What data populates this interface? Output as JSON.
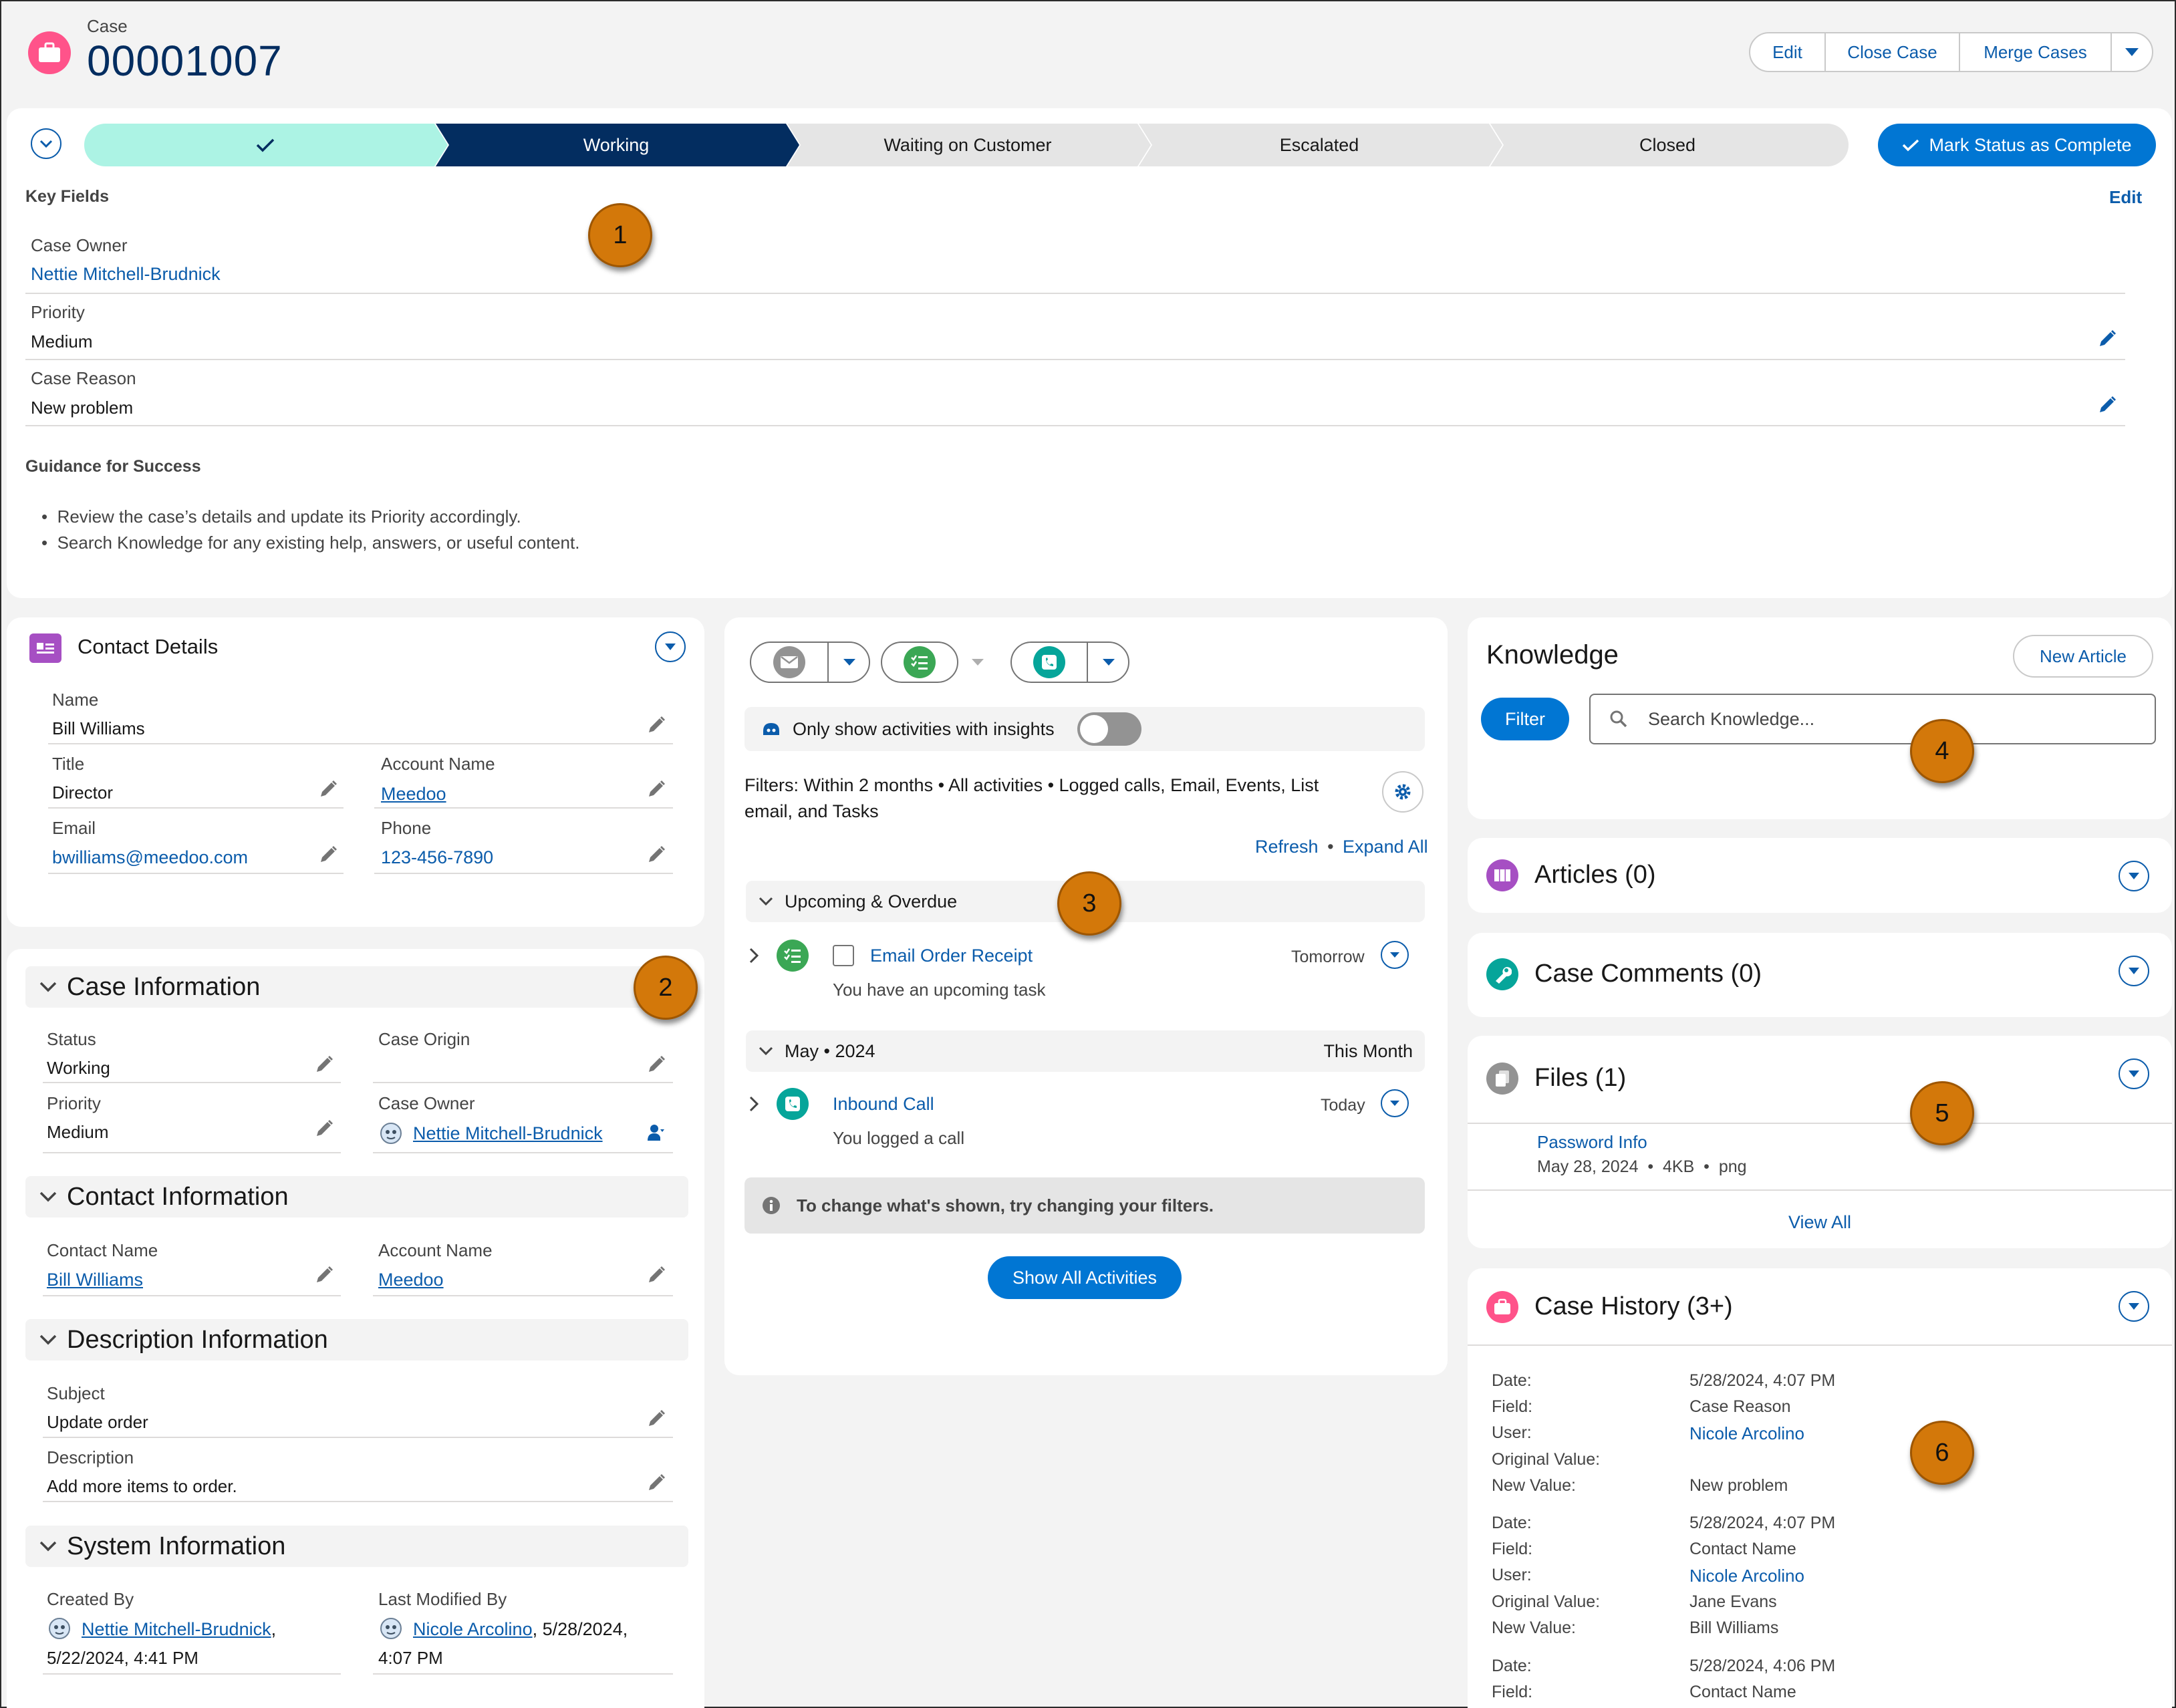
{
  "header": {
    "object_label": "Case",
    "record_number": "00001007",
    "buttons": {
      "edit": "Edit",
      "close_case": "Close Case",
      "merge_cases": "Merge Cases"
    }
  },
  "path": {
    "steps": [
      "Working",
      "Waiting on Customer",
      "Escalated",
      "Closed"
    ],
    "mark_complete": "Mark Status as Complete"
  },
  "key_fields": {
    "title": "Key Fields",
    "edit": "Edit",
    "case_owner_label": "Case Owner",
    "case_owner": "Nettie Mitchell-Brudnick",
    "priority_label": "Priority",
    "priority": "Medium",
    "case_reason_label": "Case Reason",
    "case_reason": "New problem",
    "guidance_title": "Guidance for Success",
    "guidance": [
      "Review the case’s details and update its Priority accordingly.",
      "Search Knowledge for any existing help, answers, or useful content."
    ]
  },
  "contact_details": {
    "title": "Contact Details",
    "name_label": "Name",
    "name": "Bill Williams",
    "title_label": "Title",
    "title_value": "Director",
    "account_label": "Account Name",
    "account": "Meedoo",
    "email_label": "Email",
    "email": "bwilliams@meedoo.com",
    "phone_label": "Phone",
    "phone": "123-456-7890"
  },
  "case_info": {
    "title": "Case Information",
    "status_label": "Status",
    "status": "Working",
    "origin_label": "Case Origin",
    "priority_label": "Priority",
    "priority": "Medium",
    "owner_label": "Case Owner",
    "owner": "Nettie Mitchell-Brudnick"
  },
  "contact_info": {
    "title": "Contact Information",
    "contact_name_label": "Contact Name",
    "contact_name": "Bill Williams",
    "account_label": "Account Name",
    "account": "Meedoo"
  },
  "description_info": {
    "title": "Description Information",
    "subject_label": "Subject",
    "subject": "Update order",
    "description_label": "Description",
    "description": "Add more items to order."
  },
  "system_info": {
    "title": "System Information",
    "created_label": "Created By",
    "created_by": "Nettie Mitchell-Brudnick",
    "created_sep": ",",
    "created_date": "5/22/2024, 4:41 PM",
    "modified_label": "Last Modified By",
    "modified_by": "Nicole Arcolino",
    "modified_date_a": ", 5/28/2024,",
    "modified_date_b": "4:07 PM"
  },
  "activity": {
    "insights": "Only show activities with insights",
    "filters": "Filters: Within 2 months • All activities • Logged calls, Email, Events, List email, and Tasks",
    "refresh": "Refresh",
    "sep": "•",
    "expand_all": "Expand All",
    "upcoming": "Upcoming & Overdue",
    "task_title": "Email Order Receipt",
    "task_due": "Tomorrow",
    "task_sub": "You have an upcoming task",
    "month": "May • 2024",
    "month_tag": "This Month",
    "call_title": "Inbound Call",
    "call_when": "Today",
    "call_sub": "You logged a call",
    "info": "To change what's shown, try changing your filters.",
    "show_all": "Show All Activities"
  },
  "knowledge": {
    "title": "Knowledge",
    "new_article": "New Article",
    "filter": "Filter",
    "search_placeholder": "Search Knowledge..."
  },
  "articles": {
    "title": "Articles (0)"
  },
  "comments": {
    "title": "Case Comments (0)"
  },
  "files": {
    "title": "Files (1)",
    "file_name": "Password Info",
    "file_meta": "May 28, 2024  •  4KB  •  png",
    "view_all": "View All"
  },
  "history": {
    "title": "Case History (3+)",
    "labels": {
      "date": "Date:",
      "field": "Field:",
      "user": "User:",
      "orig": "Original Value:",
      "new": "New Value:"
    },
    "entries": [
      {
        "date": "5/28/2024, 4:07 PM",
        "field": "Case Reason",
        "user": "Nicole Arcolino",
        "orig": "",
        "new": "New problem"
      },
      {
        "date": "5/28/2024, 4:07 PM",
        "field": "Contact Name",
        "user": "Nicole Arcolino",
        "orig": "Jane Evans",
        "new": "Bill Williams"
      },
      {
        "date": "5/28/2024, 4:06 PM",
        "field": "Contact Name"
      }
    ]
  },
  "callouts": [
    "1",
    "2",
    "3",
    "4",
    "5",
    "6"
  ],
  "colors": {
    "brand": "#0176d3",
    "navy": "#032d60",
    "link": "#0b5cab",
    "case_pink": "#ff538a",
    "callout": "#d3780a",
    "path_done": "#acf3e4"
  }
}
